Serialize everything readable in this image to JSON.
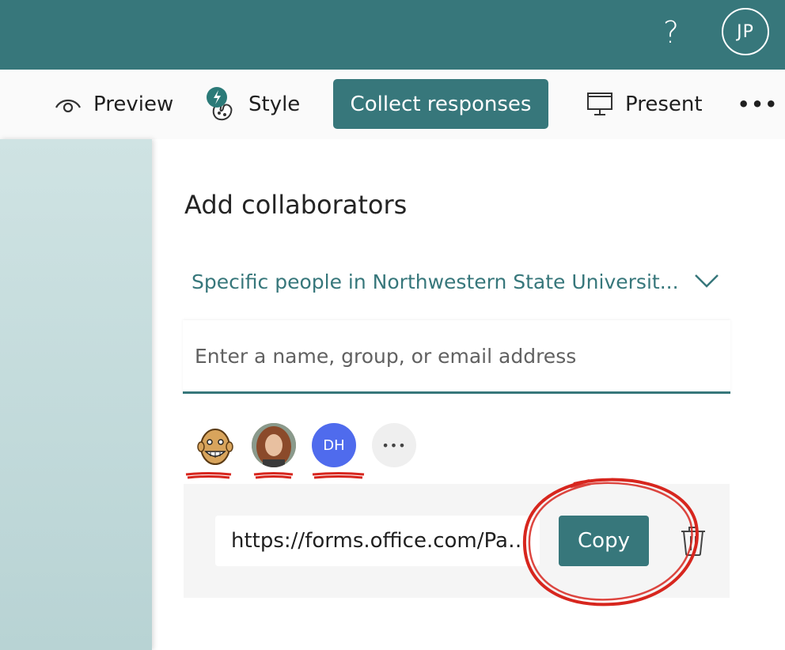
{
  "header": {
    "help_label": "?",
    "user_initials": "JP"
  },
  "toolbar": {
    "preview_label": "Preview",
    "style_label": "Style",
    "collect_label": "Collect responses",
    "present_label": "Present",
    "more_label": "•••"
  },
  "panel": {
    "title": "Add collaborators",
    "scope_value": "Specific people in Northwestern State Universit...",
    "search_placeholder": "Enter a name, group, or email address",
    "collaborators": [
      {
        "type": "avatar-cartoon"
      },
      {
        "type": "avatar-photo"
      },
      {
        "type": "initials",
        "initials": "DH",
        "color": "#4f6bed"
      },
      {
        "type": "more",
        "label": "•••"
      }
    ],
    "share_link": "https://forms.office.com/Pages/DesignPageV2.aspx",
    "copy_label": "Copy"
  },
  "colors": {
    "brand": "#37777b",
    "annotation": "#d7261e"
  }
}
